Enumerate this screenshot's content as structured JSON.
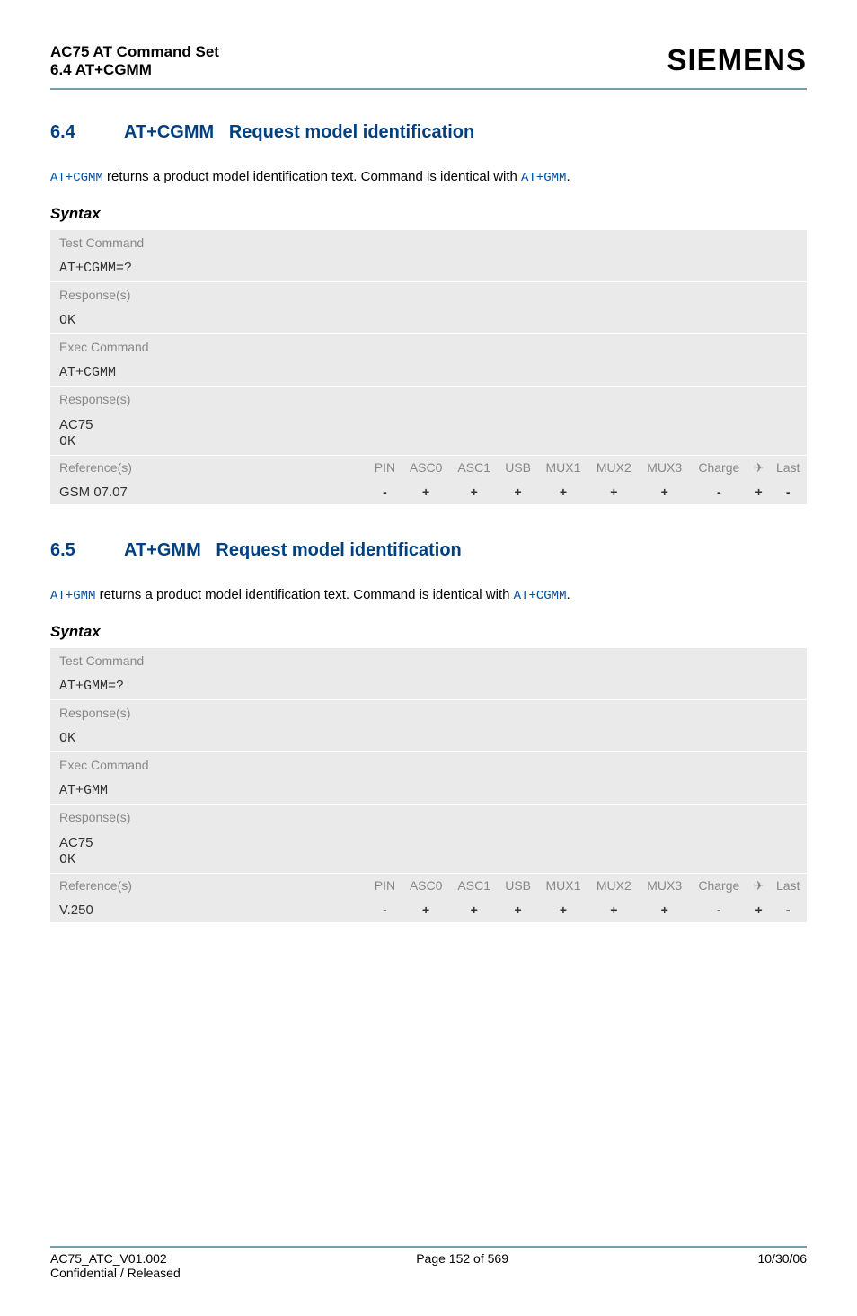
{
  "header": {
    "line1": "AC75 AT Command Set",
    "line2": "6.4 AT+CGMM",
    "logo": "SIEMENS"
  },
  "section1": {
    "num": "6.4",
    "title_cmd": "AT+CGMM",
    "title_rest": "Request model identification",
    "para_pre": "AT+CGMM",
    "para_mid": " returns a product model identification text. Command is identical with ",
    "para_post": "AT+GMM",
    "para_end": ".",
    "syntax": "Syntax",
    "test_label": "Test Command",
    "test_cmd": "AT+CGMM=?",
    "resp_label1": "Response(s)",
    "ok1": "OK",
    "exec_label": "Exec Command",
    "exec_cmd": "AT+CGMM",
    "resp_label2": "Response(s)",
    "model": "AC75",
    "ok2": "OK",
    "ref_label": "Reference(s)",
    "cols": {
      "pin": "PIN",
      "asc0": "ASC0",
      "asc1": "ASC1",
      "usb": "USB",
      "mux1": "MUX1",
      "mux2": "MUX2",
      "mux3": "MUX3",
      "charge": "Charge",
      "arrow": "✈",
      "last": "Last"
    },
    "ref_val": "GSM 07.07",
    "vals": {
      "pin": "-",
      "asc0": "+",
      "asc1": "+",
      "usb": "+",
      "mux1": "+",
      "mux2": "+",
      "mux3": "+",
      "charge": "-",
      "arrow": "+",
      "last": "-"
    }
  },
  "section2": {
    "num": "6.5",
    "title_cmd": "AT+GMM",
    "title_rest": "Request model identification",
    "para_pre": "AT+GMM",
    "para_mid": " returns a product model identification text. Command is identical with ",
    "para_post": "AT+CGMM",
    "para_end": ".",
    "syntax": "Syntax",
    "test_label": "Test Command",
    "test_cmd": "AT+GMM=?",
    "resp_label1": "Response(s)",
    "ok1": "OK",
    "exec_label": "Exec Command",
    "exec_cmd": "AT+GMM",
    "resp_label2": "Response(s)",
    "model": "AC75",
    "ok2": "OK",
    "ref_label": "Reference(s)",
    "cols": {
      "pin": "PIN",
      "asc0": "ASC0",
      "asc1": "ASC1",
      "usb": "USB",
      "mux1": "MUX1",
      "mux2": "MUX2",
      "mux3": "MUX3",
      "charge": "Charge",
      "arrow": "✈",
      "last": "Last"
    },
    "ref_val": "V.250",
    "vals": {
      "pin": "-",
      "asc0": "+",
      "asc1": "+",
      "usb": "+",
      "mux1": "+",
      "mux2": "+",
      "mux3": "+",
      "charge": "-",
      "arrow": "+",
      "last": "-"
    }
  },
  "footer": {
    "left1": "AC75_ATC_V01.002",
    "center": "Page 152 of 569",
    "right": "10/30/06",
    "left2": "Confidential / Released"
  }
}
